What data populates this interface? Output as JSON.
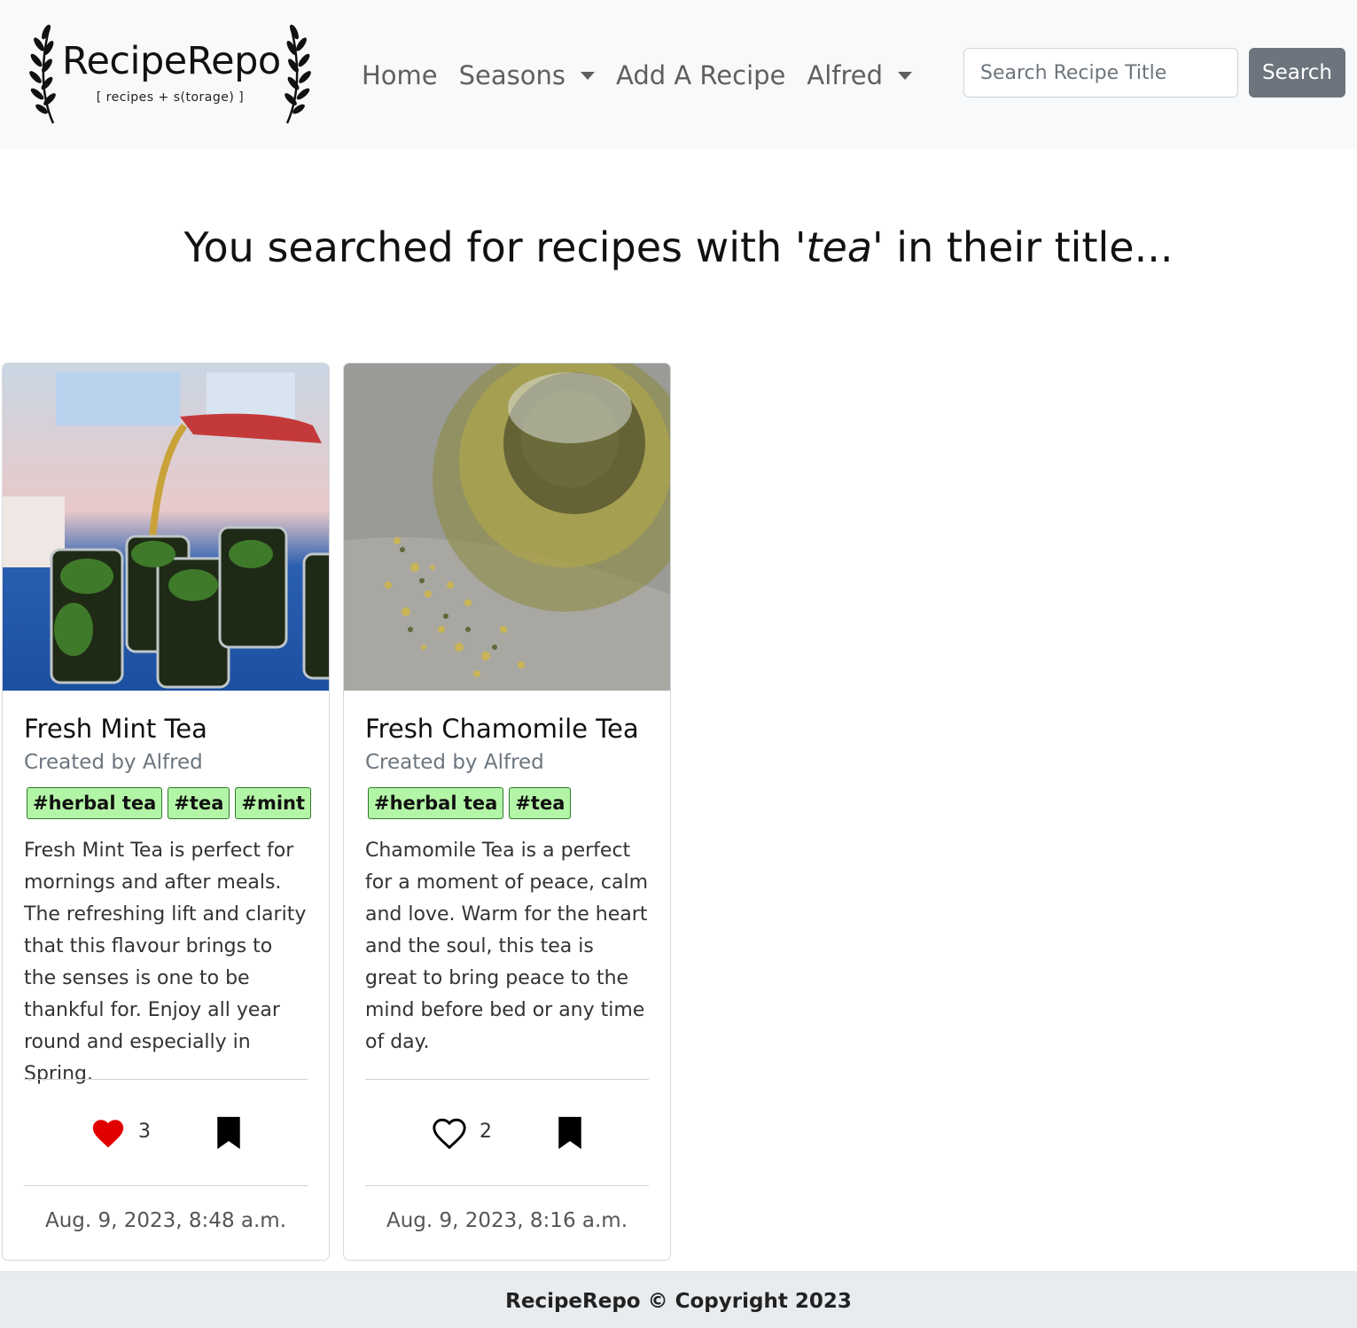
{
  "navbar": {
    "brand_name": "RecipeRepo",
    "brand_tagline": "[ recipes + s(torage) ]",
    "links": [
      {
        "label": "Home",
        "dropdown": false
      },
      {
        "label": "Seasons",
        "dropdown": true
      },
      {
        "label": "Add A Recipe",
        "dropdown": false
      },
      {
        "label": "Alfred",
        "dropdown": true
      }
    ],
    "search": {
      "placeholder": "Search Recipe Title",
      "value": "",
      "button_label": "Search"
    }
  },
  "results": {
    "heading_before": "You searched for recipes with '",
    "query": "tea",
    "heading_after": "' in their title..."
  },
  "recipes": [
    {
      "title": "Fresh Mint Tea",
      "author": "Created by Alfred",
      "tags": [
        "#herbal tea",
        "#tea",
        "#mint"
      ],
      "description": "Fresh Mint Tea is perfect for mornings and after meals. The refreshing lift and clarity that this flavour brings to the senses is one to be thankful for. Enjoy all year round and especially in Spring.",
      "likes": "3",
      "liked": true,
      "like_icon": "heart-filled-icon",
      "bookmark_icon": "bookmark-icon",
      "date": "Aug. 9, 2023, 8:48 a.m."
    },
    {
      "title": "Fresh Chamomile Tea",
      "author": "Created by Alfred",
      "tags": [
        "#herbal tea",
        "#tea"
      ],
      "description": "Chamomile Tea is a perfect for a moment of peace, calm and love. Warm for the heart and the soul, this tea is great to bring peace to the mind before bed or any time of day.",
      "likes": "2",
      "liked": false,
      "like_icon": "heart-outline-icon",
      "bookmark_icon": "bookmark-icon",
      "date": "Aug. 9, 2023, 8:16 a.m."
    }
  ],
  "footer": {
    "text": "RecipeRepo © Copyright 2023"
  },
  "colors": {
    "navbar_bg": "#f8f9fa",
    "tag_bg": "#b3f5a6",
    "like_red": "#e00000",
    "search_button": "#6c757d",
    "footer_bg": "#e9ecef"
  }
}
